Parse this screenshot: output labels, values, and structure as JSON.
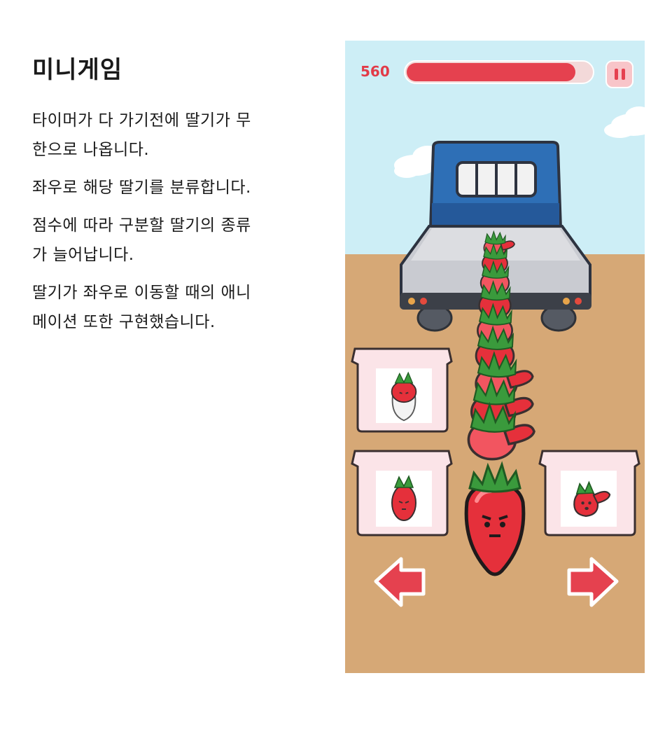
{
  "description": {
    "title": "미니게임",
    "paragraphs": [
      "타이머가 다 가기전에 딸기가 무\n한으로 나옵니다.",
      "좌우로 해당 딸기를 분류합니다.",
      "점수에 따라 구분할 딸기의 종류\n가 늘어납니다.",
      "딸기가 좌우로 이동할 때의 애니\n메이션 또한 구현했습니다."
    ]
  },
  "game": {
    "score": "560",
    "timer_fraction": 0.9,
    "colors": {
      "sky": "#cdeef6",
      "ground": "#d6a876",
      "truck_cab": "#2e6fb6",
      "truck_bed": "#c9cbd1",
      "strawberry": "#e5303b",
      "leaf": "#3a9a3c",
      "box": "#fbe4e8",
      "arrow": "#e5414f"
    },
    "icons": {
      "pause": "pause-icon",
      "left": "left-arrow-icon",
      "right": "right-arrow-icon"
    }
  }
}
